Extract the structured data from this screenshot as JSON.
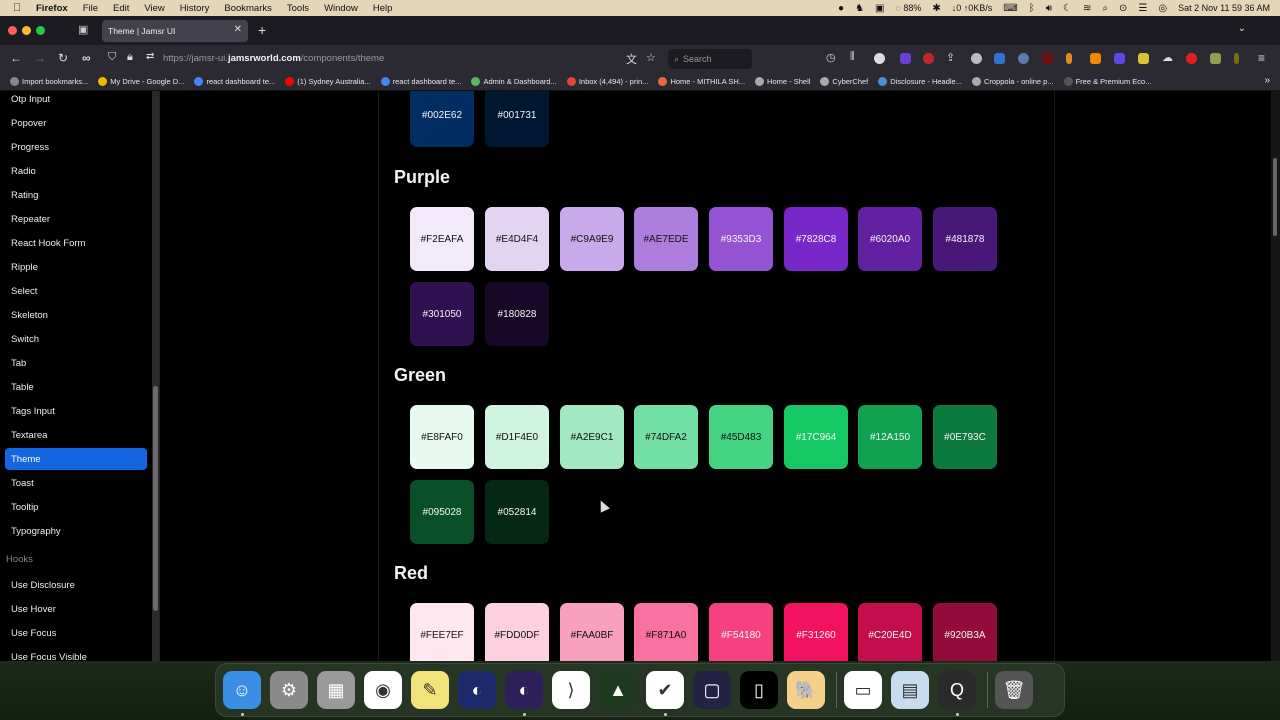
{
  "menubar": {
    "app": "Firefox",
    "items": [
      "File",
      "Edit",
      "View",
      "History",
      "Bookmarks",
      "Tools",
      "Window",
      "Help"
    ],
    "battery": "88%",
    "network": "↓0 ↑0KB/s",
    "clock": "Sat 2 Nov  11 59 36 AM"
  },
  "browser": {
    "tab_title": "Theme | Jamsr UI",
    "url_prefix": "https://jamsr-ui.",
    "url_domain": "jamsrworld.com",
    "url_path": "/components/theme",
    "search_placeholder": "Search",
    "bookmarks": [
      {
        "label": "Import bookmarks...",
        "color": "#888888"
      },
      {
        "label": "My Drive - Google D...",
        "color": "#f4b400"
      },
      {
        "label": "react dashboard te...",
        "color": "#4285f4"
      },
      {
        "label": "(1) Sydney Australia...",
        "color": "#ff0000"
      },
      {
        "label": "react dashboard te...",
        "color": "#4285f4"
      },
      {
        "label": "Admin & Dashboard...",
        "color": "#5cb85c"
      },
      {
        "label": "Inbox (4,494) - prin...",
        "color": "#ea4335"
      },
      {
        "label": "Home - MITHILA SH...",
        "color": "#e86a3a"
      },
      {
        "label": "Home - Shell",
        "color": "#aaaaaa"
      },
      {
        "label": "CyberChef",
        "color": "#aaaaaa"
      },
      {
        "label": "Disclosure - Headle...",
        "color": "#4a90d9"
      },
      {
        "label": "Croppola - online p...",
        "color": "#aaaaaa"
      },
      {
        "label": "Free & Premium Eco...",
        "color": "#555555"
      }
    ]
  },
  "sidebar": {
    "items": [
      {
        "label": "Otp Input",
        "active": false
      },
      {
        "label": "Popover",
        "active": false
      },
      {
        "label": "Progress",
        "active": false
      },
      {
        "label": "Radio",
        "active": false
      },
      {
        "label": "Rating",
        "active": false
      },
      {
        "label": "Repeater",
        "active": false
      },
      {
        "label": "React Hook Form",
        "active": false
      },
      {
        "label": "Ripple",
        "active": false
      },
      {
        "label": "Select",
        "active": false
      },
      {
        "label": "Skeleton",
        "active": false
      },
      {
        "label": "Switch",
        "active": false
      },
      {
        "label": "Tab",
        "active": false
      },
      {
        "label": "Table",
        "active": false
      },
      {
        "label": "Tags Input",
        "active": false
      },
      {
        "label": "Textarea",
        "active": false
      },
      {
        "label": "Theme",
        "active": true
      },
      {
        "label": "Toast",
        "active": false
      },
      {
        "label": "Tooltip",
        "active": false
      },
      {
        "label": "Typography",
        "active": false
      }
    ],
    "hooks_heading": "Hooks",
    "hooks": [
      {
        "label": "Use Disclosure"
      },
      {
        "label": "Use Hover"
      },
      {
        "label": "Use Focus"
      },
      {
        "label": "Use Focus Visible"
      }
    ],
    "accent": "#1466e0"
  },
  "palette": {
    "blue_tail": [
      "#002E62",
      "#001731"
    ],
    "sections": [
      {
        "name": "Purple",
        "colors": [
          "#F2EAFA",
          "#E4D4F4",
          "#C9A9E9",
          "#AE7EDE",
          "#9353D3",
          "#7828C8",
          "#6020A0",
          "#481878",
          "#301050",
          "#180828"
        ]
      },
      {
        "name": "Green",
        "colors": [
          "#E8FAF0",
          "#D1F4E0",
          "#A2E9C1",
          "#74DFA2",
          "#45D483",
          "#17C964",
          "#12A150",
          "#0E793C",
          "#095028",
          "#052814"
        ]
      },
      {
        "name": "Red",
        "colors": [
          "#FEE7EF",
          "#FDD0DF",
          "#FAA0BF",
          "#F871A0",
          "#F54180",
          "#F31260",
          "#C20E4D",
          "#920B3A"
        ]
      }
    ]
  },
  "dock": {
    "apps": [
      {
        "name": "finder",
        "color": "#3a8ee6",
        "glyph": "☺",
        "running": true
      },
      {
        "name": "system-settings",
        "color": "#8a8a8a",
        "glyph": "⚙",
        "running": false
      },
      {
        "name": "launchpad",
        "color": "#9a9a9a",
        "glyph": "▦",
        "running": false
      },
      {
        "name": "chrome",
        "color": "#ffffff",
        "glyph": "◉",
        "running": false
      },
      {
        "name": "notes",
        "color": "#f3e27a",
        "glyph": "✎",
        "running": false
      },
      {
        "name": "firefox-developer",
        "color": "#1c2a6b",
        "glyph": "◐",
        "running": false
      },
      {
        "name": "firefox",
        "color": "#2d1f5a",
        "glyph": "◐",
        "running": true
      },
      {
        "name": "vscode",
        "color": "#ffffff",
        "glyph": "⟩",
        "running": false
      },
      {
        "name": "vlc",
        "color": "#1e3a1e",
        "glyph": "▲",
        "running": false
      },
      {
        "name": "todo",
        "color": "#ffffff",
        "glyph": "✔",
        "running": true
      },
      {
        "name": "simulator",
        "color": "#222244",
        "glyph": "▢",
        "running": false
      },
      {
        "name": "notion-like",
        "color": "#000000",
        "glyph": "▯",
        "running": false
      },
      {
        "name": "tableplus",
        "color": "#f5d08a",
        "glyph": "🐘",
        "running": false
      },
      {
        "name": "cleanmymac",
        "color": "#ffffff",
        "glyph": "▭",
        "running": false
      },
      {
        "name": "preview",
        "color": "#c8dcf0",
        "glyph": "▤",
        "running": false
      },
      {
        "name": "quicktime",
        "color": "#2a2a2a",
        "glyph": "Q",
        "running": true
      },
      {
        "name": "trash",
        "color": "#555555",
        "glyph": "🗑",
        "running": false
      }
    ]
  }
}
